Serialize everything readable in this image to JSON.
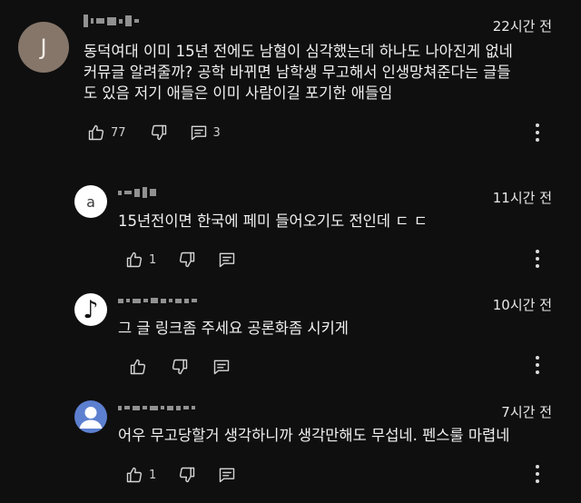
{
  "comments": [
    {
      "avatar_letter": "J",
      "time": "22시간 전",
      "text": "동덕여대 이미 15년 전에도 남혐이 심각했는데 하나도 나아진게 없네\n커뮤글 알려줄까? 공학 바뀌면 남학생 무고해서 인생망쳐준다는 글들\n도 있음 저기 애들은 이미 사람이길 포기한 애들임",
      "like_count": "77",
      "reply_count": "3"
    },
    {
      "avatar_letter": "a",
      "time": "11시간 전",
      "text": "15년전이면 한국에 페미 들어오기도 전인데 ㄷ ㄷ",
      "like_count": "1"
    },
    {
      "avatar_icon": "music-note-icon",
      "avatar_glyph": "♪",
      "time": "10시간 전",
      "text": "그 글 링크좀 주세요 공론화좀 시키게"
    },
    {
      "avatar_icon": "default-person-icon",
      "time": "7시간 전",
      "text": "어우 무고당할거 생각하니까 생각만해도 무섭네. 펜스룰 마렵네",
      "like_count": "1"
    }
  ],
  "icons": {
    "like": "thumbs-up-icon",
    "dislike": "thumbs-down-icon",
    "reply": "reply-icon",
    "menu": "more-vert-icon"
  },
  "colors": {
    "background": "#0f0f0f",
    "avatar_main": "#86766a",
    "avatar_person": "#5c7fcf"
  }
}
